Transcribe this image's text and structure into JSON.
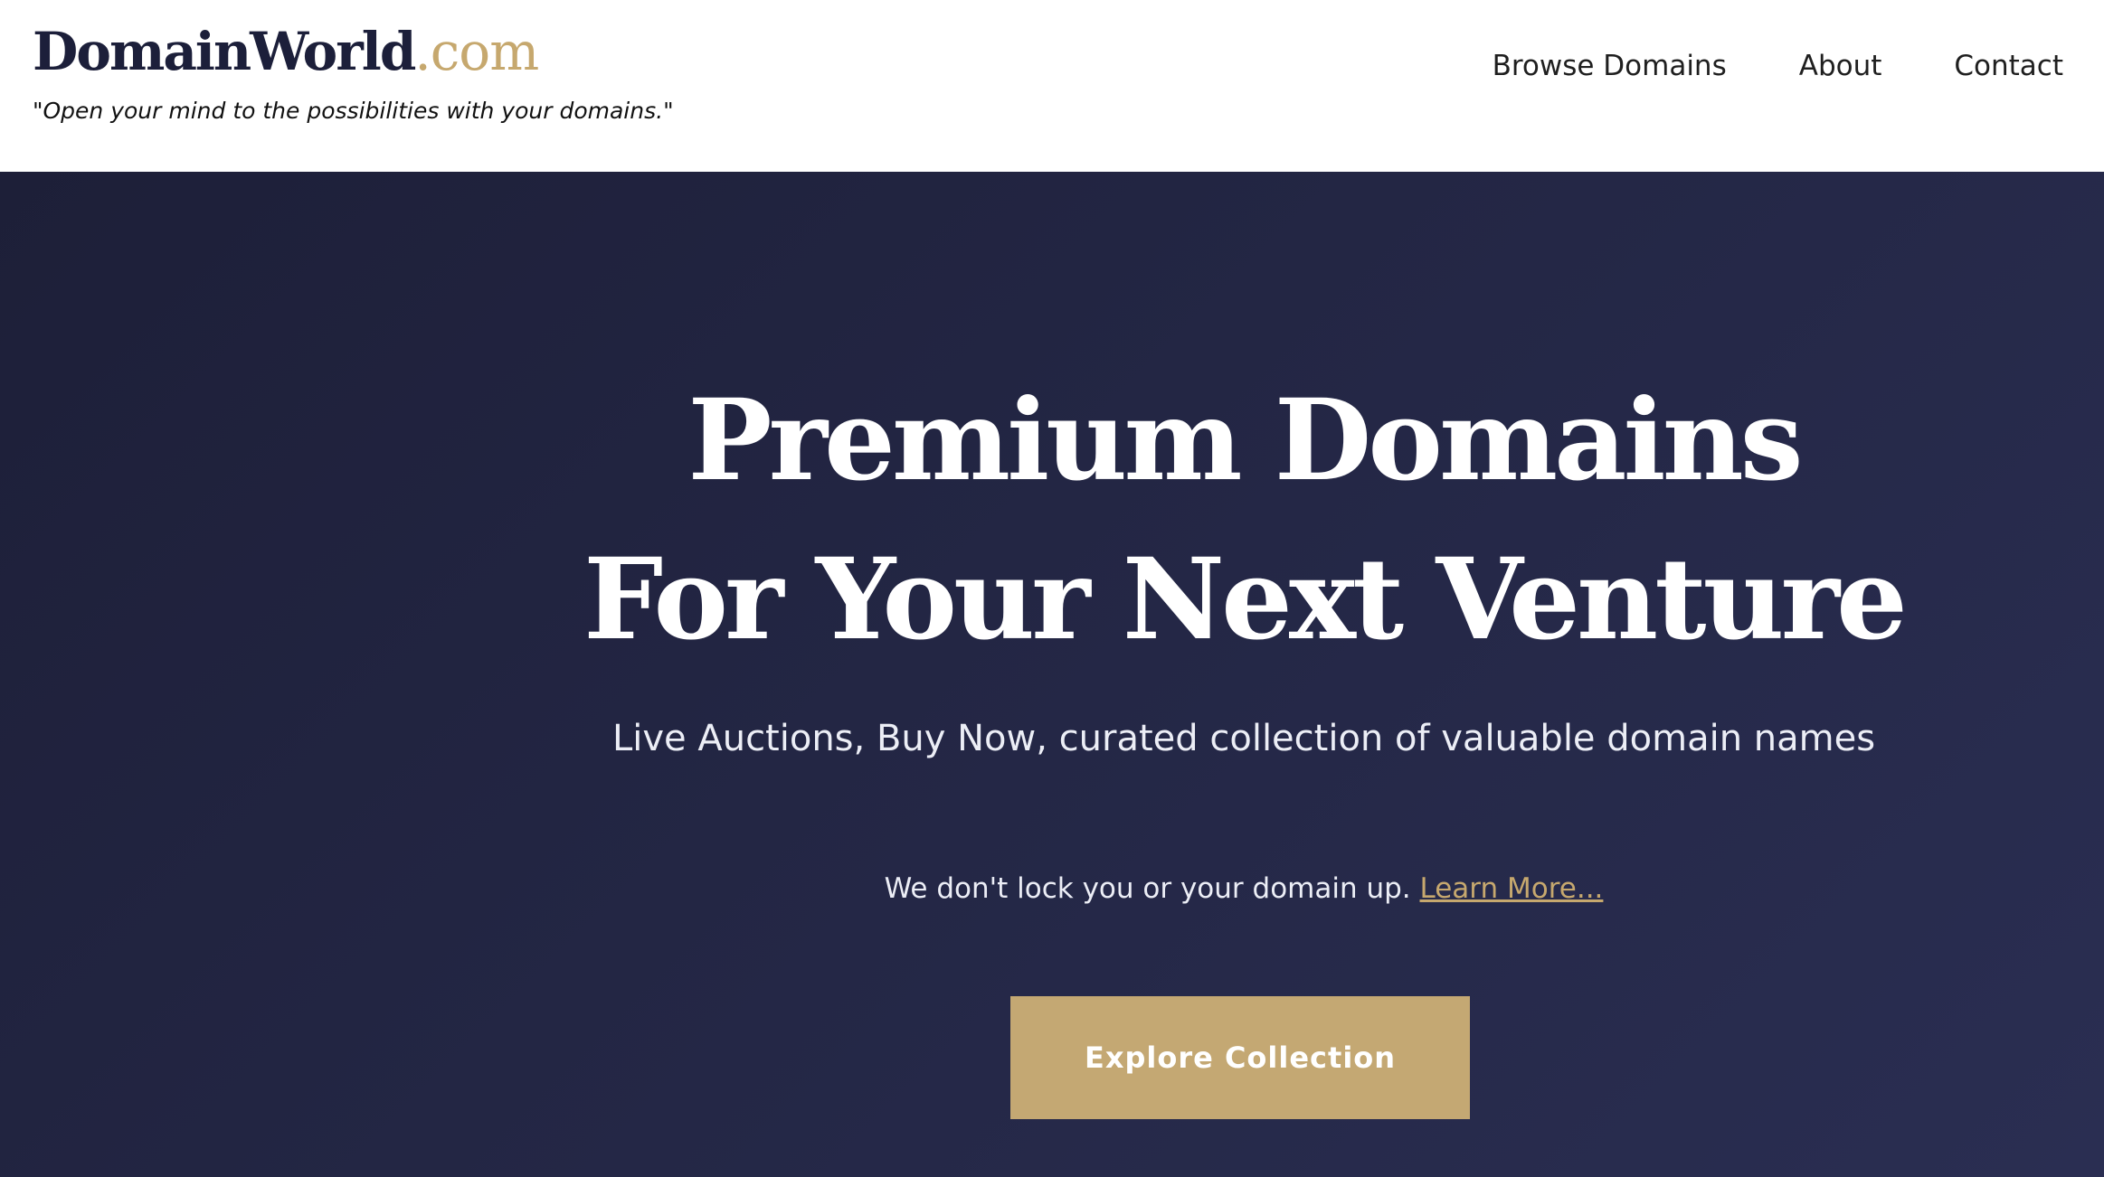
{
  "header": {
    "logo_main": "DomainWorld",
    "logo_tld": ".com",
    "tagline": "\"Open your mind to the possibilities with your domains.\"",
    "nav": [
      {
        "label": "Browse Domains"
      },
      {
        "label": "About"
      },
      {
        "label": "Contact"
      }
    ]
  },
  "hero": {
    "title_line1": "Premium Domains",
    "title_line2": "For Your Next Venture",
    "subtitle": "Live Auctions, Buy Now, curated collection of valuable domain names",
    "note": "We don't lock you or your domain up. ",
    "note_link": "Learn More...",
    "cta_label": "Explore Collection"
  },
  "colors": {
    "brand_navy": "#1c1f3a",
    "accent_gold": "#c4a873",
    "hero_bg": "#232644"
  }
}
